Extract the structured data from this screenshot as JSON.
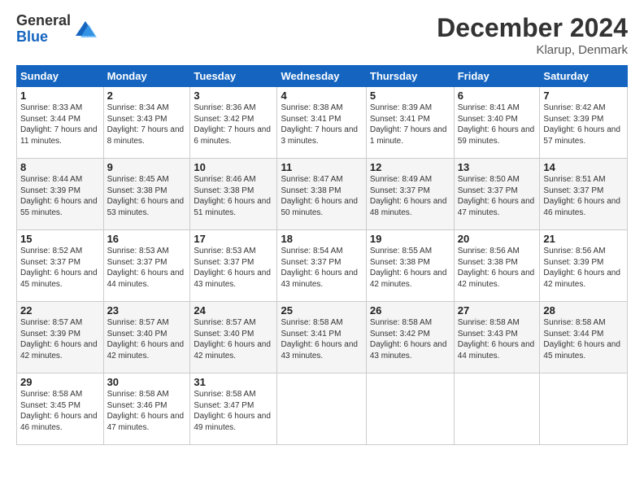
{
  "logo": {
    "general": "General",
    "blue": "Blue"
  },
  "title": "December 2024",
  "location": "Klarup, Denmark",
  "days_of_week": [
    "Sunday",
    "Monday",
    "Tuesday",
    "Wednesday",
    "Thursday",
    "Friday",
    "Saturday"
  ],
  "weeks": [
    [
      {
        "day": "1",
        "sunrise": "8:33 AM",
        "sunset": "3:44 PM",
        "daylight": "7 hours and 11 minutes."
      },
      {
        "day": "2",
        "sunrise": "8:34 AM",
        "sunset": "3:43 PM",
        "daylight": "7 hours and 8 minutes."
      },
      {
        "day": "3",
        "sunrise": "8:36 AM",
        "sunset": "3:42 PM",
        "daylight": "7 hours and 6 minutes."
      },
      {
        "day": "4",
        "sunrise": "8:38 AM",
        "sunset": "3:41 PM",
        "daylight": "7 hours and 3 minutes."
      },
      {
        "day": "5",
        "sunrise": "8:39 AM",
        "sunset": "3:41 PM",
        "daylight": "7 hours and 1 minute."
      },
      {
        "day": "6",
        "sunrise": "8:41 AM",
        "sunset": "3:40 PM",
        "daylight": "6 hours and 59 minutes."
      },
      {
        "day": "7",
        "sunrise": "8:42 AM",
        "sunset": "3:39 PM",
        "daylight": "6 hours and 57 minutes."
      }
    ],
    [
      {
        "day": "8",
        "sunrise": "8:44 AM",
        "sunset": "3:39 PM",
        "daylight": "6 hours and 55 minutes."
      },
      {
        "day": "9",
        "sunrise": "8:45 AM",
        "sunset": "3:38 PM",
        "daylight": "6 hours and 53 minutes."
      },
      {
        "day": "10",
        "sunrise": "8:46 AM",
        "sunset": "3:38 PM",
        "daylight": "6 hours and 51 minutes."
      },
      {
        "day": "11",
        "sunrise": "8:47 AM",
        "sunset": "3:38 PM",
        "daylight": "6 hours and 50 minutes."
      },
      {
        "day": "12",
        "sunrise": "8:49 AM",
        "sunset": "3:37 PM",
        "daylight": "6 hours and 48 minutes."
      },
      {
        "day": "13",
        "sunrise": "8:50 AM",
        "sunset": "3:37 PM",
        "daylight": "6 hours and 47 minutes."
      },
      {
        "day": "14",
        "sunrise": "8:51 AM",
        "sunset": "3:37 PM",
        "daylight": "6 hours and 46 minutes."
      }
    ],
    [
      {
        "day": "15",
        "sunrise": "8:52 AM",
        "sunset": "3:37 PM",
        "daylight": "6 hours and 45 minutes."
      },
      {
        "day": "16",
        "sunrise": "8:53 AM",
        "sunset": "3:37 PM",
        "daylight": "6 hours and 44 minutes."
      },
      {
        "day": "17",
        "sunrise": "8:53 AM",
        "sunset": "3:37 PM",
        "daylight": "6 hours and 43 minutes."
      },
      {
        "day": "18",
        "sunrise": "8:54 AM",
        "sunset": "3:37 PM",
        "daylight": "6 hours and 43 minutes."
      },
      {
        "day": "19",
        "sunrise": "8:55 AM",
        "sunset": "3:38 PM",
        "daylight": "6 hours and 42 minutes."
      },
      {
        "day": "20",
        "sunrise": "8:56 AM",
        "sunset": "3:38 PM",
        "daylight": "6 hours and 42 minutes."
      },
      {
        "day": "21",
        "sunrise": "8:56 AM",
        "sunset": "3:39 PM",
        "daylight": "6 hours and 42 minutes."
      }
    ],
    [
      {
        "day": "22",
        "sunrise": "8:57 AM",
        "sunset": "3:39 PM",
        "daylight": "6 hours and 42 minutes."
      },
      {
        "day": "23",
        "sunrise": "8:57 AM",
        "sunset": "3:40 PM",
        "daylight": "6 hours and 42 minutes."
      },
      {
        "day": "24",
        "sunrise": "8:57 AM",
        "sunset": "3:40 PM",
        "daylight": "6 hours and 42 minutes."
      },
      {
        "day": "25",
        "sunrise": "8:58 AM",
        "sunset": "3:41 PM",
        "daylight": "6 hours and 43 minutes."
      },
      {
        "day": "26",
        "sunrise": "8:58 AM",
        "sunset": "3:42 PM",
        "daylight": "6 hours and 43 minutes."
      },
      {
        "day": "27",
        "sunrise": "8:58 AM",
        "sunset": "3:43 PM",
        "daylight": "6 hours and 44 minutes."
      },
      {
        "day": "28",
        "sunrise": "8:58 AM",
        "sunset": "3:44 PM",
        "daylight": "6 hours and 45 minutes."
      }
    ],
    [
      {
        "day": "29",
        "sunrise": "8:58 AM",
        "sunset": "3:45 PM",
        "daylight": "6 hours and 46 minutes."
      },
      {
        "day": "30",
        "sunrise": "8:58 AM",
        "sunset": "3:46 PM",
        "daylight": "6 hours and 47 minutes."
      },
      {
        "day": "31",
        "sunrise": "8:58 AM",
        "sunset": "3:47 PM",
        "daylight": "6 hours and 49 minutes."
      },
      null,
      null,
      null,
      null
    ]
  ]
}
